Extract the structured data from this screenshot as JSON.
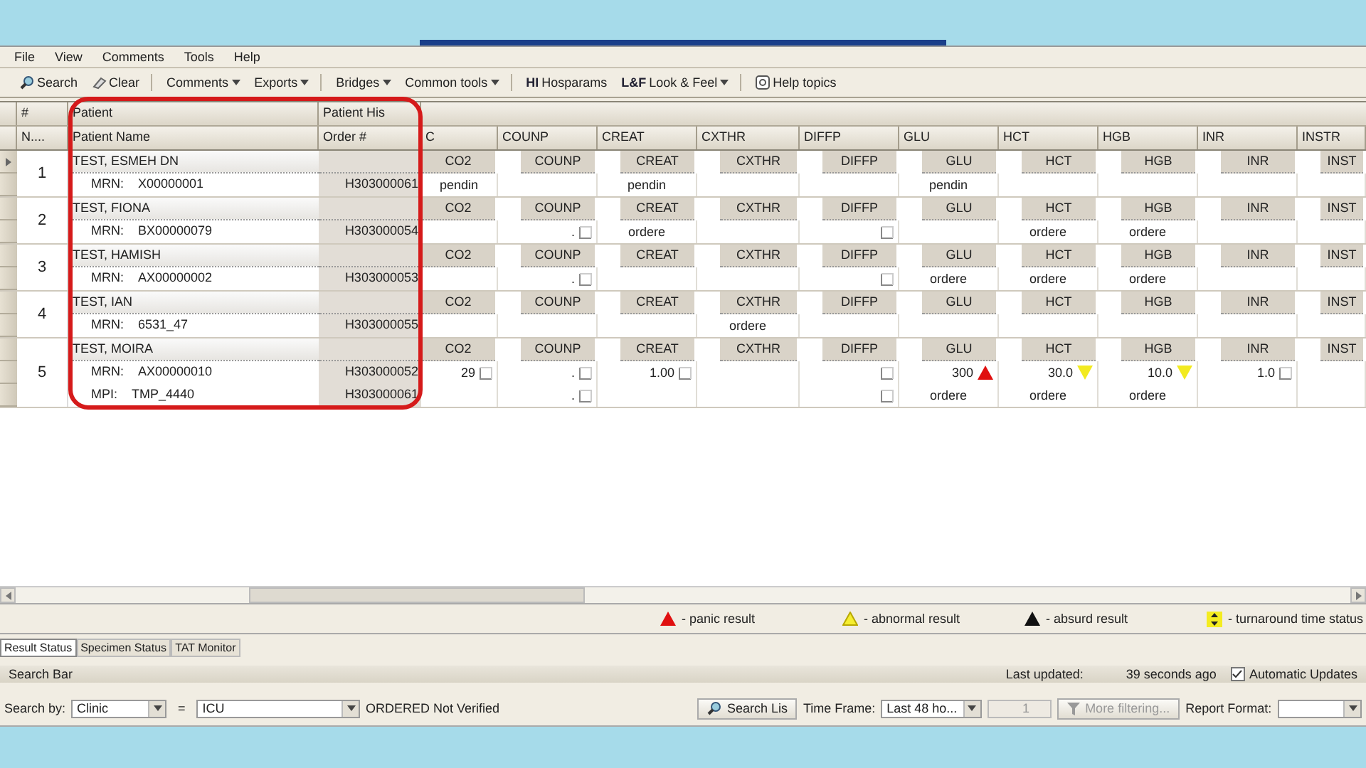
{
  "menu": [
    "File",
    "View",
    "Comments",
    "Tools",
    "Help"
  ],
  "toolbar": [
    [
      {
        "label": "Search",
        "kind": "search"
      },
      {
        "label": "Clear",
        "kind": "clear"
      }
    ],
    [
      {
        "label": "Comments",
        "dropdown": true
      },
      {
        "label": "Exports",
        "dropdown": true
      }
    ],
    [
      {
        "label": "Bridges",
        "dropdown": true
      },
      {
        "label": "Common tools",
        "dropdown": true
      }
    ],
    [
      {
        "label": "Hosparams",
        "badge": "HI"
      },
      {
        "label": "Look & Feel",
        "badge": "L&F",
        "dropdown": true
      }
    ],
    [
      {
        "label": "Help topics",
        "kind": "help"
      }
    ]
  ],
  "header_groups": [
    "#",
    "Patient",
    "Patient His"
  ],
  "columns": [
    "N....",
    "Patient Name",
    "Order #",
    "C",
    "COUNP",
    "CREAT",
    "CXTHR",
    "DIFFP",
    "GLU",
    "HCT",
    "HGB",
    "INR",
    "INSTR"
  ],
  "patients": [
    {
      "number": "1",
      "selected": true,
      "name": "TEST, ESMEH DN",
      "tests": [
        "CO2",
        "COUNP",
        "CREAT",
        "CXTHR",
        "DIFFP",
        "GLU",
        "HCT",
        "HGB",
        "INR",
        "INST"
      ],
      "lines": [
        {
          "id_label": "MRN:",
          "id_value": "X00000001",
          "order": "H303000061",
          "results": {
            "co2": {
              "text": "pendin"
            },
            "creat": {
              "text": "pendin"
            },
            "glu": {
              "text": "pendin"
            }
          }
        }
      ]
    },
    {
      "number": "2",
      "selected": false,
      "name": "TEST, FIONA",
      "tests": [
        "CO2",
        "COUNP",
        "CREAT",
        "CXTHR",
        "DIFFP",
        "GLU",
        "HCT",
        "HGB",
        "INR",
        "INST"
      ],
      "lines": [
        {
          "id_label": "MRN:",
          "id_value": "BX00000079",
          "order": "H303000054",
          "results": {
            "counp": {
              "text": ".",
              "kind": "box"
            },
            "creat": {
              "text": "ordere"
            },
            "diffp": {
              "kind": "box"
            },
            "hct": {
              "text": "ordere"
            },
            "hgb": {
              "text": "ordere"
            }
          }
        }
      ]
    },
    {
      "number": "3",
      "selected": false,
      "name": "TEST, HAMISH",
      "tests": [
        "CO2",
        "COUNP",
        "CREAT",
        "CXTHR",
        "DIFFP",
        "GLU",
        "HCT",
        "HGB",
        "INR",
        "INST"
      ],
      "lines": [
        {
          "id_label": "MRN:",
          "id_value": "AX00000002",
          "order": "H303000053",
          "results": {
            "counp": {
              "text": ".",
              "kind": "box"
            },
            "diffp": {
              "kind": "box"
            },
            "glu": {
              "text": "ordere"
            },
            "hct": {
              "text": "ordere"
            },
            "hgb": {
              "text": "ordere"
            }
          }
        }
      ]
    },
    {
      "number": "4",
      "selected": false,
      "name": "TEST, IAN",
      "tests": [
        "CO2",
        "COUNP",
        "CREAT",
        "CXTHR",
        "DIFFP",
        "GLU",
        "HCT",
        "HGB",
        "INR",
        "INST"
      ],
      "lines": [
        {
          "id_label": "MRN:",
          "id_value": "6531_47",
          "order": "H303000055",
          "results": {
            "cxthr": {
              "text": "ordere"
            }
          }
        }
      ]
    },
    {
      "number": "5",
      "selected": false,
      "name": "TEST, MOIRA",
      "tests": [
        "CO2",
        "COUNP",
        "CREAT",
        "CXTHR",
        "DIFFP",
        "GLU",
        "HCT",
        "HGB",
        "INR",
        "INST"
      ],
      "lines": [
        {
          "id_label": "MRN:",
          "id_value": "AX00000010",
          "order": "H303000052",
          "results": {
            "co2": {
              "text": "29",
              "kind": "box"
            },
            "counp": {
              "text": ".",
              "kind": "box"
            },
            "creat": {
              "text": "1.00",
              "kind": "box"
            },
            "diffp": {
              "kind": "box"
            },
            "glu": {
              "text": "300",
              "kind": "panic"
            },
            "hct": {
              "text": "30.0",
              "kind": "abnormal"
            },
            "hgb": {
              "text": "10.0",
              "kind": "abnormal"
            },
            "inr": {
              "text": "1.0",
              "kind": "box"
            }
          }
        },
        {
          "id_label": "MPI:",
          "id_value": "TMP_4440",
          "order": "H303000061",
          "results": {
            "counp": {
              "text": ".",
              "kind": "box"
            },
            "diffp": {
              "kind": "box"
            },
            "glu": {
              "text": "ordere"
            },
            "hct": {
              "text": "ordere"
            },
            "hgb": {
              "text": "ordere"
            }
          }
        }
      ]
    }
  ],
  "legend": [
    {
      "kind": "panic",
      "label": "- panic result"
    },
    {
      "kind": "abnormal",
      "label": "- abnormal result"
    },
    {
      "kind": "absurd",
      "label": "- absurd result"
    },
    {
      "kind": "tat",
      "label": "- turnaround time status"
    }
  ],
  "tabs": [
    {
      "label": "Result Status",
      "selected": true
    },
    {
      "label": "Specimen Status",
      "selected": false
    },
    {
      "label": "TAT Monitor",
      "selected": false
    }
  ],
  "search_bar": {
    "title": "Search Bar",
    "last_updated_label": "Last updated:",
    "last_updated": "39 seconds ago",
    "auto_updates": {
      "label": "Automatic Updates",
      "checked": true
    },
    "search_by_label": "Search by:",
    "search_by": "Clinic",
    "operator": "=",
    "search_value": "ICU",
    "status_text": "ORDERED Not Verified",
    "search_button": "Search Lis",
    "time_frame_label": "Time Frame:",
    "time_frame": "Last 48 ho...",
    "spinner": "1",
    "filter_button": "More filtering...",
    "report_format_label": "Report Format:"
  }
}
